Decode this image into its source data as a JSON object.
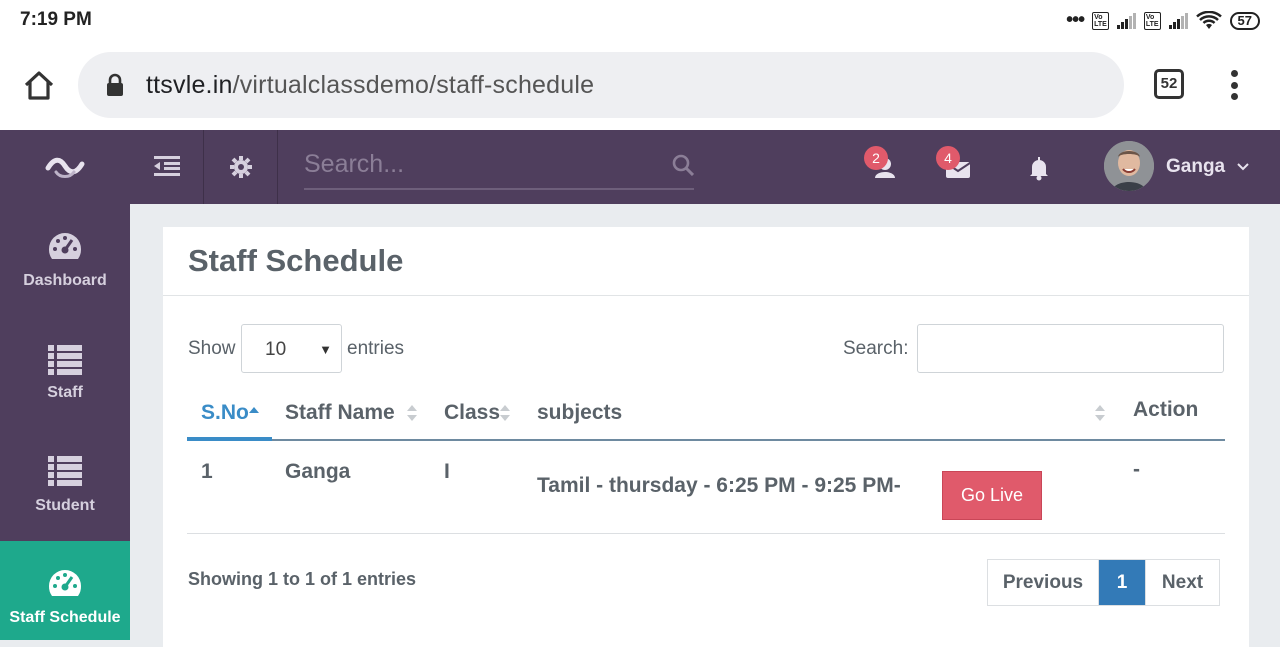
{
  "status_bar": {
    "time": "7:19 PM",
    "battery": "57",
    "volte1": "Vo LTE",
    "volte2": "Vo LTE"
  },
  "browser": {
    "url_domain": "ttsvle.in",
    "url_path": "/virtualclassdemo/staff-schedule",
    "tab_count": "52"
  },
  "sidebar": {
    "items": [
      {
        "label": "Dashboard",
        "icon": "dashboard-icon"
      },
      {
        "label": "Staff",
        "icon": "list-icon"
      },
      {
        "label": "Student",
        "icon": "list-icon"
      },
      {
        "label": "Staff Schedule",
        "icon": "dashboard-icon",
        "active": true
      }
    ]
  },
  "topnav": {
    "search_placeholder": "Search...",
    "notifications": {
      "users_count": "2",
      "mail_count": "4"
    },
    "user_name": "Ganga"
  },
  "page": {
    "title": "Staff Schedule",
    "show_label": "Show",
    "entries_value": "10",
    "entries_label": "entries",
    "search_label": "Search:",
    "columns": [
      "S.No",
      "Staff Name",
      "Class",
      "subjects",
      "Action"
    ],
    "rows": [
      {
        "sno": "1",
        "staff_name": "Ganga",
        "class": "I",
        "subjects": "Tamil - thursday - 6:25 PM - 9:25 PM-",
        "action": "-",
        "button": "Go Live"
      }
    ],
    "info": "Showing 1 to 1 of 1 entries",
    "pager": {
      "previous": "Previous",
      "current": "1",
      "next": "Next"
    }
  },
  "colors": {
    "sidebar_bg": "#4f3e5d",
    "active_item": "#1ea98c",
    "go_live": "#e05a6b",
    "link_blue": "#3a8cc7",
    "pager_active": "#337ab7"
  }
}
